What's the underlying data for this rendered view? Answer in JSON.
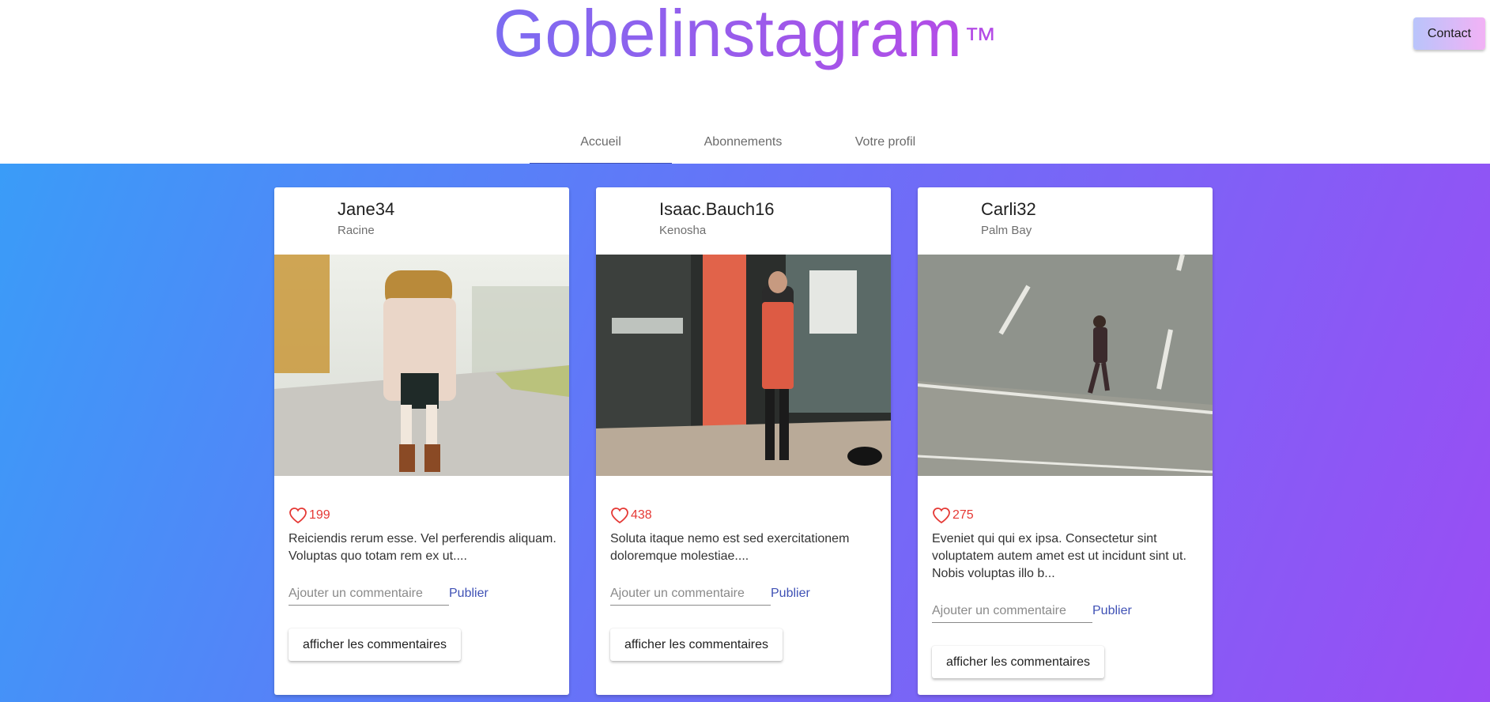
{
  "app": {
    "title": "Gobelinstagram",
    "trademark": "™"
  },
  "header": {
    "contact_label": "Contact"
  },
  "tabs": [
    {
      "label": "Accueil",
      "active": true
    },
    {
      "label": "Abonnements",
      "active": false
    },
    {
      "label": "Votre profil",
      "active": false
    }
  ],
  "posts": [
    {
      "username": "Jane34",
      "location": "Racine",
      "likes": "199",
      "caption": "Reiciendis rerum esse. Vel perferendis aliquam. Voluptas quo totam rem ex ut....",
      "comment_placeholder": "Ajouter un commentaire",
      "publish_label": "Publier",
      "show_comments_label": "afficher les commentaires"
    },
    {
      "username": "Isaac.Bauch16",
      "location": "Kenosha",
      "likes": "438",
      "caption": "Soluta itaque nemo est sed exercitationem doloremque molestiae....",
      "comment_placeholder": "Ajouter un commentaire",
      "publish_label": "Publier",
      "show_comments_label": "afficher les commentaires"
    },
    {
      "username": "Carli32",
      "location": "Palm Bay",
      "likes": "275",
      "caption": "Eveniet qui qui ex ipsa. Consectetur sint voluptatem autem amet est ut incidunt sint ut. Nobis voluptas illo b...",
      "comment_placeholder": "Ajouter un commentaire",
      "publish_label": "Publier",
      "show_comments_label": "afficher les commentaires"
    }
  ],
  "colors": {
    "accent": "#3f51b5",
    "like": "#e53935",
    "brand_start": "#7c6cf1",
    "brand_end": "#b44ce6"
  }
}
